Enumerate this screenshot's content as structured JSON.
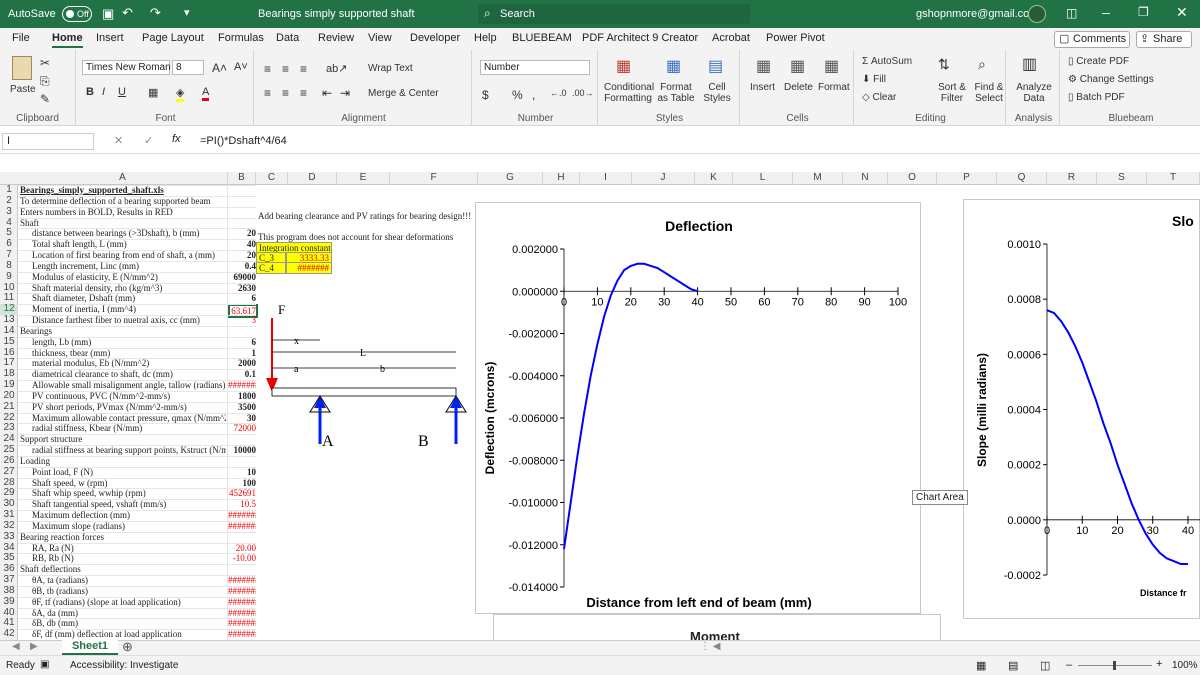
{
  "titlebar": {
    "autosave": "AutoSave",
    "autosave_state": "Off",
    "doc_title": "Bearings simply supported shaft",
    "search_placeholder": "Search",
    "account": "gshopnmore@gmail.com"
  },
  "menu": [
    "File",
    "Home",
    "Insert",
    "Page Layout",
    "Formulas",
    "Data",
    "Review",
    "View",
    "Developer",
    "Help",
    "BLUEBEAM",
    "PDF Architect 9 Creator",
    "Acrobat",
    "Power Pivot"
  ],
  "menu_right": {
    "comments": "Comments",
    "share": "Share"
  },
  "ribbon": {
    "clipboard": {
      "paste": "Paste",
      "label": "Clipboard"
    },
    "font": {
      "name": "Times New Roman",
      "size": "8",
      "label": "Font"
    },
    "alignment": {
      "wrap": "Wrap Text",
      "merge": "Merge & Center",
      "label": "Alignment"
    },
    "number": {
      "format": "Number",
      "label": "Number"
    },
    "styles": {
      "cond": "Conditional Formatting",
      "table": "Format as Table",
      "cell": "Cell Styles",
      "label": "Styles"
    },
    "cells": {
      "insert": "Insert",
      "delete": "Delete",
      "format": "Format",
      "label": "Cells"
    },
    "editing": {
      "autosum": "AutoSum",
      "fill": "Fill",
      "clear": "Clear",
      "sort": "Sort & Filter",
      "find": "Find & Select",
      "label": "Editing"
    },
    "analysis": {
      "analyze": "Analyze Data",
      "label": "Analysis"
    },
    "bluebeam": {
      "create": "Create PDF",
      "change": "Change Settings",
      "batch": "Batch PDF",
      "label": "Bluebeam"
    }
  },
  "formula_bar": {
    "name_box": "I",
    "fx": "fx",
    "formula": "=PI()*Dshaft^4/64"
  },
  "columns": [
    "A",
    "B",
    "C",
    "D",
    "E",
    "F",
    "G",
    "H",
    "I",
    "J",
    "K",
    "L",
    "M",
    "N",
    "O",
    "P",
    "Q",
    "R",
    "S",
    "T"
  ],
  "rows": [
    {
      "n": "1",
      "a": "Bearings_simply_supported_shaft.xls",
      "b": "",
      "bold": true,
      "underline": true
    },
    {
      "n": "2",
      "a": "To determine deflection of a bearing supported beam",
      "b": ""
    },
    {
      "n": "3",
      "a": "Enters numbers in BOLD, Results in RED",
      "b": ""
    },
    {
      "n": "4",
      "a": "Shaft",
      "b": ""
    },
    {
      "n": "5",
      "a": "distance between bearings (>3Dshaft), b (mm)",
      "b": "20"
    },
    {
      "n": "6",
      "a": "Total shaft length, L (mm)",
      "b": "40"
    },
    {
      "n": "7",
      "a": "Location of first bearing from end of shaft, a (mm)",
      "b": "20"
    },
    {
      "n": "8",
      "a": "Length increment, Linc (mm)",
      "b": "0.4"
    },
    {
      "n": "9",
      "a": "Modulus of elasticity, E (N/mm^2)",
      "b": "69000"
    },
    {
      "n": "10",
      "a": "Shaft material density, rho (kg/m^3)",
      "b": "2630"
    },
    {
      "n": "11",
      "a": "Shaft diameter, Dshaft (mm)",
      "b": "6"
    },
    {
      "n": "12",
      "a": "Moment of inertia, I (mm^4)",
      "b": "63.617"
    },
    {
      "n": "13",
      "a": "Distance farthest fiber to nuetral axis, cc (mm)",
      "b": "3"
    },
    {
      "n": "14",
      "a": "Bearings",
      "b": ""
    },
    {
      "n": "15",
      "a": "length, Lb (mm)",
      "b": "6"
    },
    {
      "n": "16",
      "a": "thickness, tbear (mm)",
      "b": "1"
    },
    {
      "n": "17",
      "a": "material modulus, Eb (N/mm^2)",
      "b": "2000"
    },
    {
      "n": "18",
      "a": "diametrical clearance to shaft, dc (mm)",
      "b": "0.1"
    },
    {
      "n": "19",
      "a": "Allowable small misalignment angle, tallow (radians)",
      "b": "#######"
    },
    {
      "n": "20",
      "a": "PV continuous, PVC (N/mm^2-mm/s)",
      "b": "1800"
    },
    {
      "n": "21",
      "a": "PV short periods, PVmax (N/mm^2-mm/s)",
      "b": "3500"
    },
    {
      "n": "22",
      "a": "Maximum allowable contact pressure, qmax (N/mm^2)",
      "b": "30"
    },
    {
      "n": "23",
      "a": "radial stiffness, Kbear (N/mm)",
      "b": "72000"
    },
    {
      "n": "24",
      "a": "Support structure",
      "b": ""
    },
    {
      "n": "25",
      "a": "radial stiffness at bearing support points, Kstruct (N/mm)",
      "b": "10000"
    },
    {
      "n": "26",
      "a": "Loading",
      "b": ""
    },
    {
      "n": "27",
      "a": "Point load, F (N)",
      "b": "10"
    },
    {
      "n": "28",
      "a": "Shaft speed, w (rpm)",
      "b": "100"
    },
    {
      "n": "29",
      "a": "Shaft whip speed, wwhip (rpm)",
      "b": "452691"
    },
    {
      "n": "30",
      "a": "Shaft tangential speed, vshaft (mm/s)",
      "b": "10.5"
    },
    {
      "n": "31",
      "a": "Maximum deflection (mm)",
      "b": "#######"
    },
    {
      "n": "32",
      "a": "Maximum slope (radians)",
      "b": "#######"
    },
    {
      "n": "33",
      "a": "Bearing reaction forces",
      "b": ""
    },
    {
      "n": "34",
      "a": "RA, Ra (N)",
      "b": "20.00"
    },
    {
      "n": "35",
      "a": "RB, Rb (N)",
      "b": "-10.00"
    },
    {
      "n": "36",
      "a": "Shaft deflections",
      "b": ""
    },
    {
      "n": "37",
      "a": "θA, ta (radians)",
      "b": "#######"
    },
    {
      "n": "38",
      "a": "θB, tb (radians)",
      "b": "#######"
    },
    {
      "n": "39",
      "a": "θF, tf (radians) (slope at load application)",
      "b": "#######"
    },
    {
      "n": "40",
      "a": "δA, da (mm)",
      "b": "#######"
    },
    {
      "n": "41",
      "a": "δB, db (mm)",
      "b": "#######"
    },
    {
      "n": "42",
      "a": "δF, df (mm) deflection at load application",
      "b": "#######"
    }
  ],
  "side_notes": {
    "c3": "Add bearing clearance and PV ratings for bearing design!!!",
    "c5": "This program does not account for shear deformations",
    "c6": "Integration constants",
    "c7_label": "C_3",
    "c7_val": "3333.33",
    "c8_label": "C_4",
    "c8_val": "#######"
  },
  "diagram": {
    "F": "F",
    "x": "x",
    "L": "L",
    "a": "a",
    "b": "b",
    "A": "A",
    "B": "B"
  },
  "deflection_chart": {
    "title": "Deflection",
    "xlabel": "Distance from left end of beam (mm)",
    "ylabel": "Deflection (mcrons)",
    "y_ticks": [
      "0.002000",
      "0.000000",
      "-0.002000",
      "-0.004000",
      "-0.006000",
      "-0.008000",
      "-0.010000",
      "-0.012000",
      "-0.014000"
    ],
    "x_ticks": [
      "0",
      "10",
      "20",
      "30",
      "40",
      "50",
      "60",
      "70",
      "80",
      "90",
      "100"
    ]
  },
  "slope_chart": {
    "title": "Slo",
    "ylabel": "Slope (milli radians)",
    "xlabel": "Distance fr",
    "y_ticks": [
      "0.0010",
      "0.0008",
      "0.0006",
      "0.0004",
      "0.0002",
      "0.0000",
      "-0.0002"
    ],
    "x_ticks": [
      "0",
      "10",
      "20",
      "30",
      "40"
    ],
    "tooltip": "Chart Area"
  },
  "moment_chart": {
    "title": "Moment"
  },
  "chart_data": [
    {
      "type": "line",
      "title": "Deflection",
      "xlabel": "Distance from left end of beam (mm)",
      "ylabel": "Deflection (mcrons)",
      "xlim": [
        0,
        100
      ],
      "ylim": [
        -0.014,
        0.002
      ],
      "series": [
        {
          "x": [
            0,
            2,
            4,
            6,
            8,
            10,
            12,
            14,
            16,
            18,
            20,
            22,
            24,
            26,
            28,
            30,
            32,
            34,
            36,
            38,
            40
          ],
          "y": [
            -0.0122,
            -0.01,
            -0.0078,
            -0.0058,
            -0.004,
            -0.0025,
            -0.0012,
            -0.0002,
            0.0005,
            0.001,
            0.0012,
            0.0013,
            0.0013,
            0.0012,
            0.0011,
            0.0009,
            0.0007,
            0.0005,
            0.0003,
            0.0001,
            0.0
          ],
          "color": "#0000ff"
        }
      ]
    },
    {
      "type": "line",
      "title": "Slo",
      "ylabel": "Slope (milli radians)",
      "xlim": [
        0,
        40
      ],
      "ylim": [
        -0.0002,
        0.001
      ],
      "series": [
        {
          "x": [
            0,
            2,
            4,
            6,
            8,
            10,
            12,
            14,
            16,
            18,
            20,
            22,
            24,
            26,
            28,
            30,
            32,
            34,
            36,
            38,
            40
          ],
          "y": [
            0.00076,
            0.00075,
            0.00072,
            0.00068,
            0.00063,
            0.00057,
            0.0005,
            0.00043,
            0.00035,
            0.00028,
            0.0002,
            0.00013,
            6e-05,
            0.0,
            -5e-05,
            -9e-05,
            -0.00012,
            -0.00014,
            -0.00015,
            -0.00016,
            -0.00016
          ],
          "color": "#0000ff"
        }
      ]
    }
  ],
  "sheet_tab": "Sheet1",
  "status": {
    "ready": "Ready",
    "accessibility": "Accessibility: Investigate",
    "zoom": "100%"
  }
}
